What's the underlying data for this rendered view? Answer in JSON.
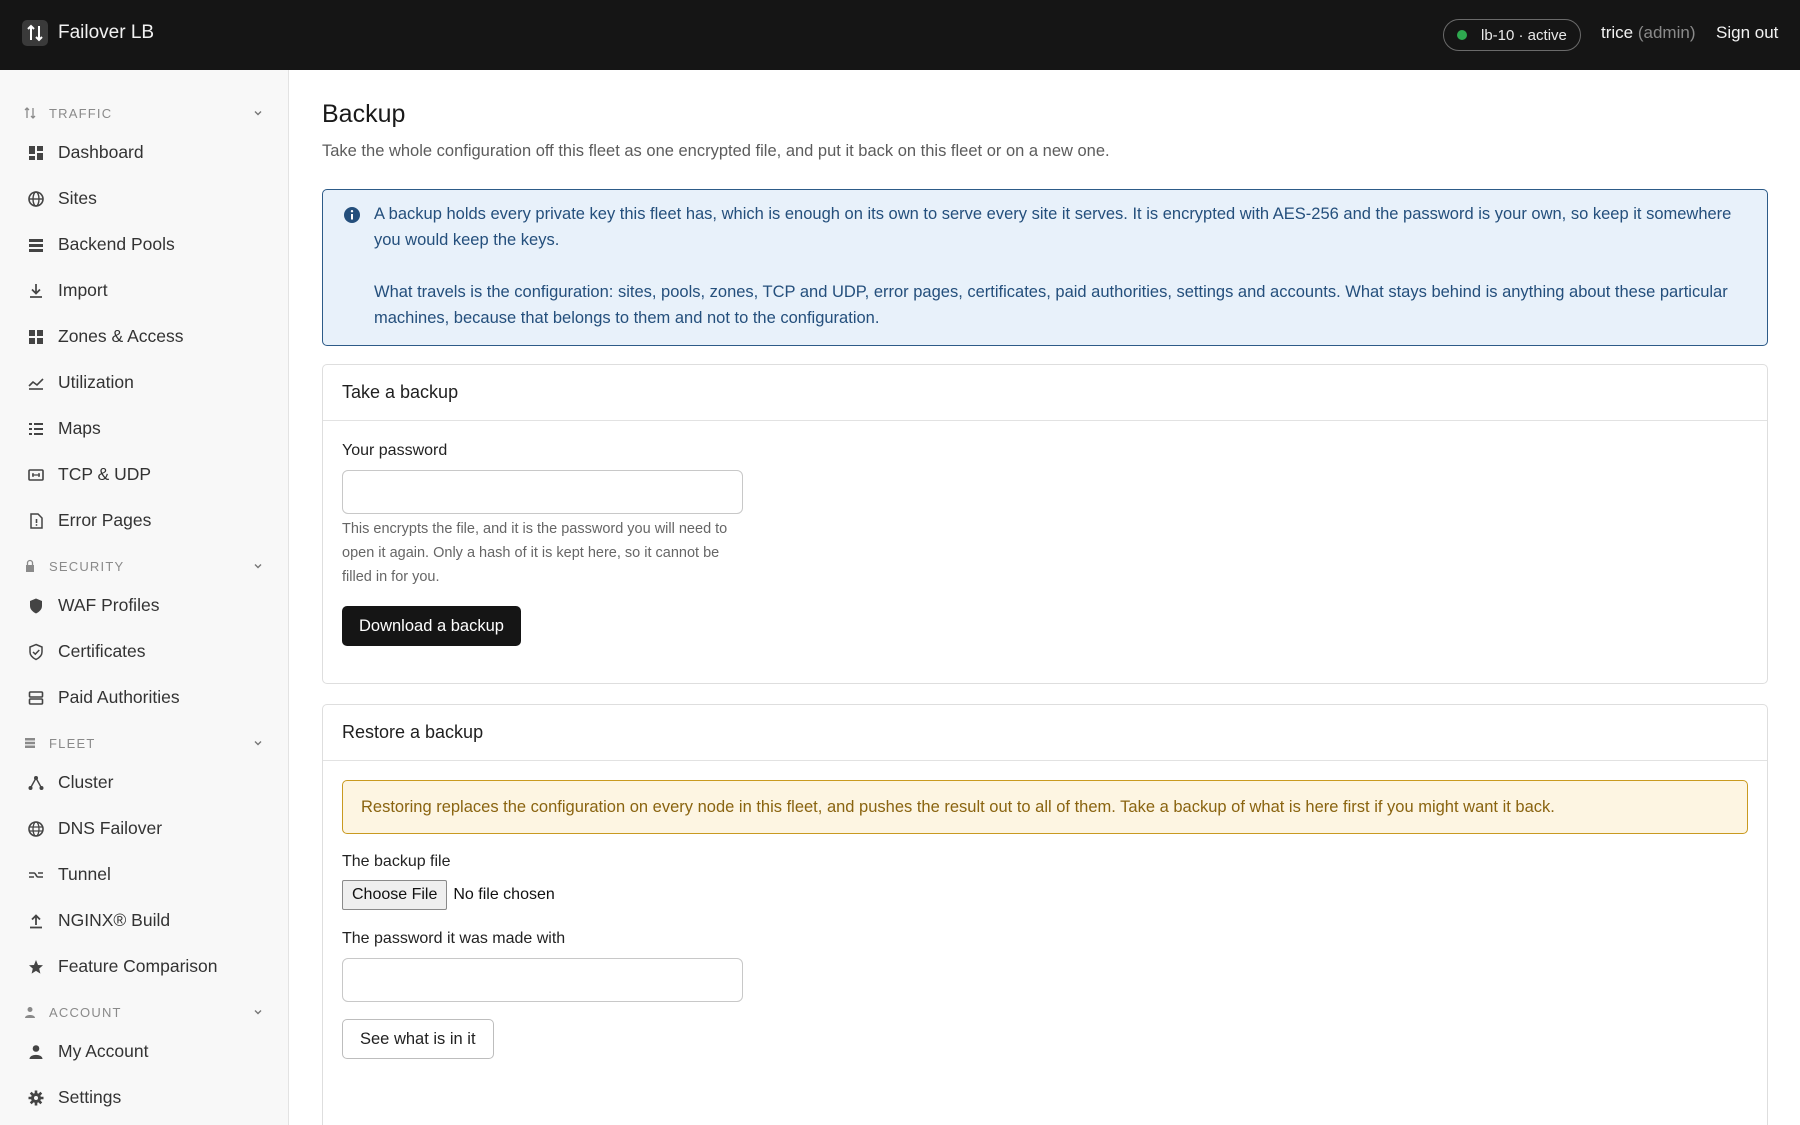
{
  "header": {
    "app_name": "Failover LB",
    "node_status": "lb-10 · active",
    "status_color": "#2ea84f",
    "user_name": "trice",
    "user_role": "(admin)",
    "signout_label": "Sign out"
  },
  "sidebar": {
    "traffic": {
      "label": "TRAFFIC",
      "items": [
        {
          "label": "Dashboard",
          "icon": "dashboard-icon"
        },
        {
          "label": "Sites",
          "icon": "globe-icon"
        },
        {
          "label": "Backend Pools",
          "icon": "stack-icon"
        },
        {
          "label": "Import",
          "icon": "download-icon"
        },
        {
          "label": "Zones & Access",
          "icon": "grid-icon"
        },
        {
          "label": "Utilization",
          "icon": "chart-line-icon"
        },
        {
          "label": "Maps",
          "icon": "list-icon"
        },
        {
          "label": "TCP & UDP",
          "icon": "ethernet-icon"
        },
        {
          "label": "Error Pages",
          "icon": "file-alert-icon"
        }
      ]
    },
    "security": {
      "label": "SECURITY",
      "items": [
        {
          "label": "WAF Profiles",
          "icon": "shield-icon"
        },
        {
          "label": "Certificates",
          "icon": "shield-check-icon"
        },
        {
          "label": "Paid Authorities",
          "icon": "server-icon"
        }
      ]
    },
    "fleet": {
      "label": "FLEET",
      "items": [
        {
          "label": "Cluster",
          "icon": "cluster-icon"
        },
        {
          "label": "DNS Failover",
          "icon": "dns-globe-icon"
        },
        {
          "label": "Tunnel",
          "icon": "tunnel-icon"
        },
        {
          "label": "NGINX® Build",
          "icon": "upload-icon"
        },
        {
          "label": "Feature Comparison",
          "icon": "star-icon"
        }
      ]
    },
    "account": {
      "label": "ACCOUNT",
      "items": [
        {
          "label": "My Account",
          "icon": "person-icon"
        },
        {
          "label": "Settings",
          "icon": "gear-icon"
        }
      ]
    }
  },
  "main": {
    "title": "Backup",
    "subtitle": "Take the whole configuration off this fleet as one encrypted file, and put it back on this fleet or on a new one.",
    "info": {
      "p1": "A backup holds every private key this fleet has, which is enough on its own to serve every site it serves. It is encrypted with AES-256 and the password is your own, so keep it somewhere you would keep the keys.",
      "p2": "What travels is the configuration: sites, pools, zones, TCP and UDP, error pages, certificates, paid authorities, settings and accounts. What stays behind is anything about these particular machines, because that belongs to them and not to the configuration."
    },
    "take_backup": {
      "title": "Take a backup",
      "password_label": "Your password",
      "password_value": "",
      "hint": "This encrypts the file, and it is the password you will need to open it again. Only a hash of it is kept here, so it cannot be filled in for you.",
      "button": "Download a backup"
    },
    "restore_backup": {
      "title": "Restore a backup",
      "warning": "Restoring replaces the configuration on every node in this fleet, and pushes the result out to all of them. Take a backup of what is here first if you might want it back.",
      "file_label": "The backup file",
      "file_button": "Choose File",
      "file_status": "No file chosen",
      "password_label": "The password it was made with",
      "password_value": "",
      "button": "See what is in it"
    }
  }
}
